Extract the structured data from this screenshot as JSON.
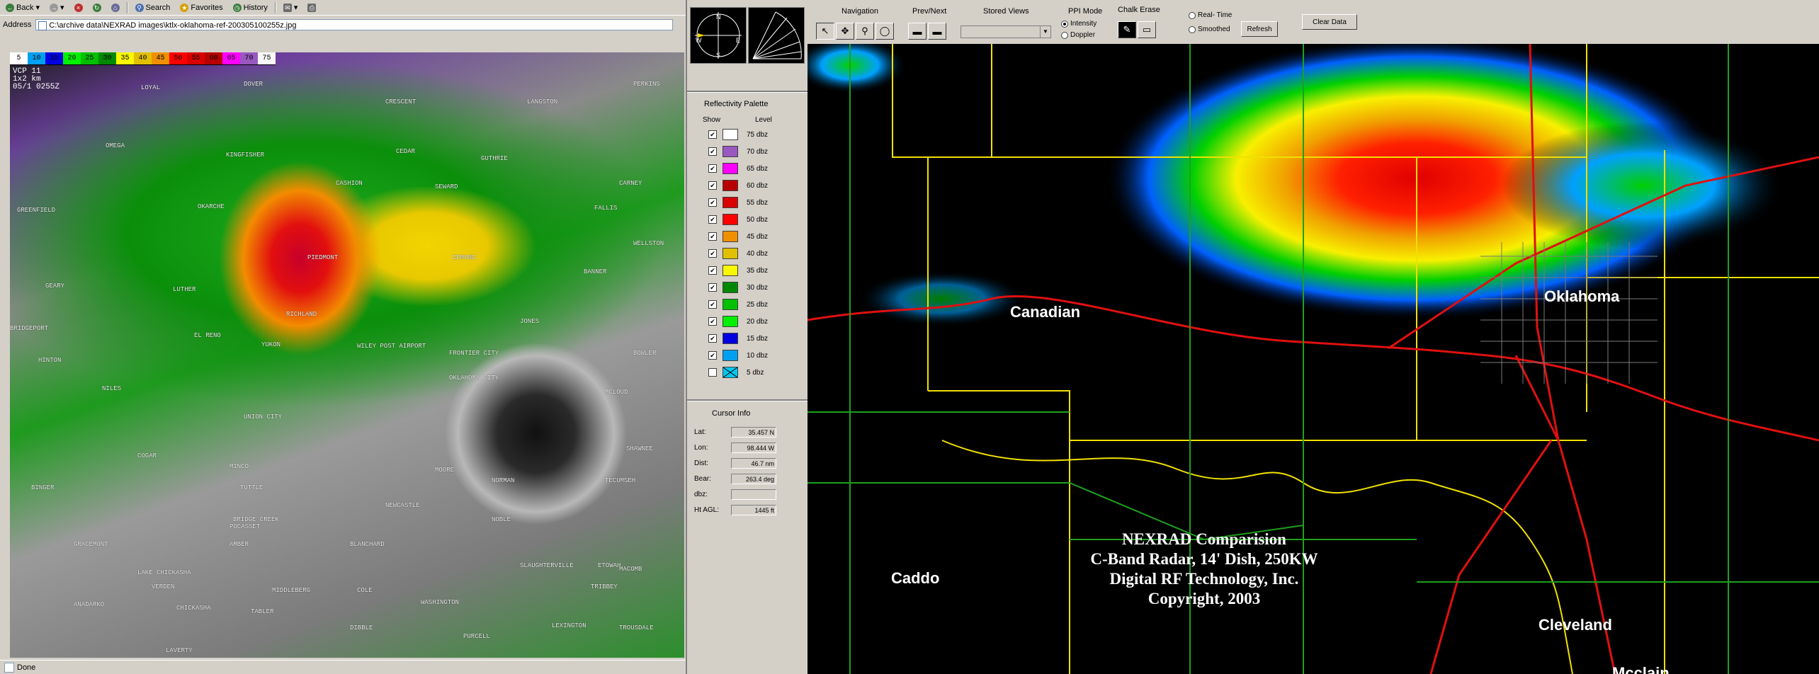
{
  "browser": {
    "toolbar": {
      "back": "Back",
      "search": "Search",
      "favorites": "Favorites",
      "history": "History"
    },
    "address_label": "Address",
    "address_value": "C:\\archive data\\NEXRAD images\\ktlx-oklahoma-ref-200305100255z.jpg",
    "status": "Done"
  },
  "nexrad_image": {
    "dbz_scale": [
      "5",
      "10",
      "15",
      "20",
      "25",
      "30",
      "35",
      "40",
      "45",
      "50",
      "55",
      "60",
      "65",
      "70",
      "75"
    ],
    "dbz_colors": [
      "#ffffff",
      "#00a0f0",
      "#0000e0",
      "#00f000",
      "#00c000",
      "#008800",
      "#f8f800",
      "#e0c000",
      "#f09000",
      "#ff0000",
      "#d80000",
      "#b80000",
      "#ff00ff",
      "#9858c0",
      "#f8f8f8"
    ],
    "vcp_lines": [
      "VCP 11",
      "1x2 km",
      "05/1 0255Z"
    ],
    "towns": [
      "DOVER",
      "LOYAL",
      "PERKINS",
      "CRESCENT",
      "LANGSTON",
      "OMEGA",
      "KINGFISHER",
      "CEDAR",
      "GUTHRIE",
      "CASHION",
      "SEWARD",
      "CARNEY",
      "GREENFIELD",
      "OKARCHE",
      "FALLIS",
      "WELLSTON",
      "PIEDMONT",
      "EDMOND",
      "GEARY",
      "LUTHER",
      "BANNER",
      "RICHLAND",
      "JONES",
      "BRIDGEPORT",
      "EL RENO",
      "YUKON",
      "WILEY POST AIRPORT",
      "FRONTIER CITY",
      "BOWLER",
      "HINTON",
      "OKLAHOMA CITY",
      "MCLOUD",
      "NILES",
      "UNION CITY",
      "SHAWNEE",
      "COGAR",
      "MINCO",
      "TUTTLE",
      "MOORE",
      "NORMAN",
      "TECUMSEH",
      "BINGER",
      "BRIDGE CREEK",
      "AMBER",
      "BLANCHARD",
      "NEWCASTLE",
      "SLAUGHTERVILLE",
      "ETOWAH",
      "GRACEMONT",
      "POCASSET",
      "NOBLE",
      "MACOMB",
      "LAKE CHICKASHA",
      "VERDEN",
      "MIDDLEBERG",
      "COLE",
      "ANADARKO",
      "CHICKASHA",
      "TABLER",
      "WASHINGTON",
      "DIBBLE",
      "PURCELL",
      "LEXINGTON",
      "TRIBBEY",
      "TROUSDALE",
      "LAVERTY"
    ]
  },
  "controls": {
    "palette_title": "Reflectivity Palette",
    "show_label": "Show",
    "level_label": "Level",
    "palette": [
      {
        "level": "75 dbz",
        "color": "#ffffff",
        "checked": true
      },
      {
        "level": "70 dbz",
        "color": "#9858c0",
        "checked": true
      },
      {
        "level": "65 dbz",
        "color": "#ff00ff",
        "checked": true
      },
      {
        "level": "60 dbz",
        "color": "#b80000",
        "checked": true
      },
      {
        "level": "55 dbz",
        "color": "#d80000",
        "checked": true
      },
      {
        "level": "50 dbz",
        "color": "#ff0000",
        "checked": true
      },
      {
        "level": "45 dbz",
        "color": "#f09000",
        "checked": true
      },
      {
        "level": "40 dbz",
        "color": "#e0c000",
        "checked": true
      },
      {
        "level": "35 dbz",
        "color": "#f8f800",
        "checked": true
      },
      {
        "level": "30 dbz",
        "color": "#008800",
        "checked": true
      },
      {
        "level": "25 dbz",
        "color": "#00c000",
        "checked": true
      },
      {
        "level": "20 dbz",
        "color": "#00f000",
        "checked": true
      },
      {
        "level": "15 dbz",
        "color": "#0000e0",
        "checked": true
      },
      {
        "level": "10 dbz",
        "color": "#00a0f0",
        "checked": true
      },
      {
        "level": "5 dbz",
        "color": "#00c8f0",
        "checked": false
      }
    ],
    "compass_letters": {
      "n": "N",
      "s": "S",
      "e": "E",
      "w": "W"
    },
    "cursor_title": "Cursor Info",
    "cursor": [
      {
        "label": "Lat:",
        "value": "35.457 N"
      },
      {
        "label": "Lon:",
        "value": "98.444 W"
      },
      {
        "label": "Dist:",
        "value": "46.7 nm"
      },
      {
        "label": "Bear:",
        "value": "263.4 deg"
      },
      {
        "label": "dbz:",
        "value": ""
      },
      {
        "label": "Ht AGL:",
        "value": "1445 ft"
      }
    ]
  },
  "topbar": {
    "navigation": "Navigation",
    "prev_next": "Prev/Next",
    "stored_views": "Stored Views",
    "ppi_mode": "PPI Mode",
    "intensity": "Intensity",
    "doppler": "Doppler",
    "chalk_erase": "Chalk Erase",
    "real_time": "Real- Time",
    "smoothed": "Smoothed",
    "refresh": "Refresh",
    "clear_data": "Clear Data"
  },
  "map": {
    "counties": {
      "canadian": "Canadian",
      "oklahoma": "Oklahoma",
      "caddo": "Caddo",
      "cleveland": "Cleveland",
      "mcclain": "Mcclain"
    },
    "caption": [
      "NEXRAD Comparision",
      "C-Band Radar, 14' Dish, 250KW",
      "Digital RF Technology, Inc.",
      "Copyright, 2003"
    ]
  }
}
